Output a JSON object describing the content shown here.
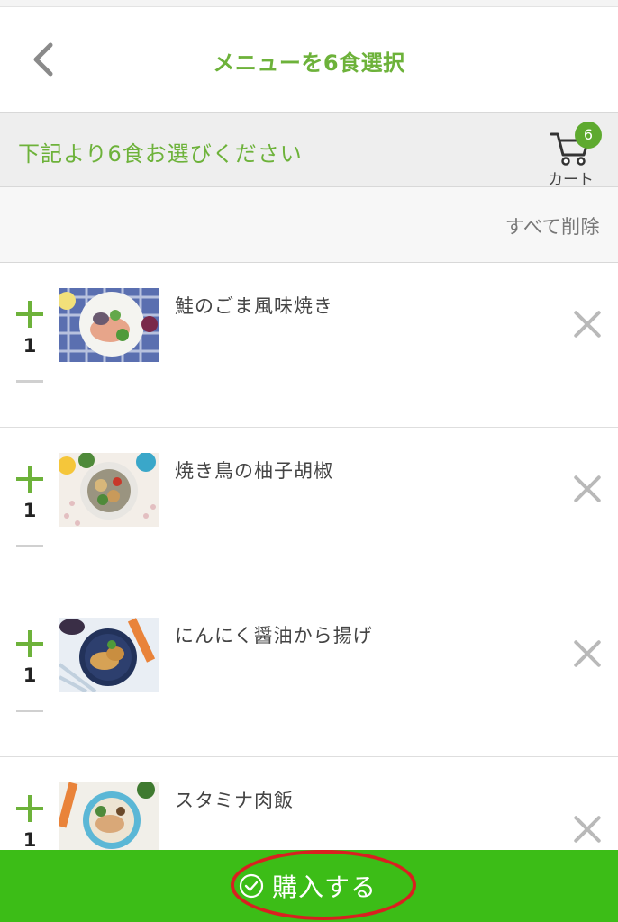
{
  "header": {
    "back_icon": "chevron-left-icon",
    "title": "メニューを6食選択"
  },
  "subheader": {
    "instruction": "下記より6食お選びください",
    "cart_icon": "cart-icon",
    "cart_count": "6",
    "cart_label": "カート"
  },
  "toolbar": {
    "delete_all": "すべて削除"
  },
  "items": [
    {
      "name": "鮭のごま風味焼き",
      "qty": "1"
    },
    {
      "name": "焼き鳥の柚子胡椒",
      "qty": "1"
    },
    {
      "name": "にんにく醤油から揚げ",
      "qty": "1"
    },
    {
      "name": "スタミナ肉飯",
      "qty": "1"
    }
  ],
  "footer": {
    "buy_label": "購入する",
    "check_icon": "check-circle-icon"
  },
  "colors": {
    "accent_green": "#6db23a",
    "buy_bar_green": "#3cbd17",
    "highlight_red": "#d92020"
  }
}
